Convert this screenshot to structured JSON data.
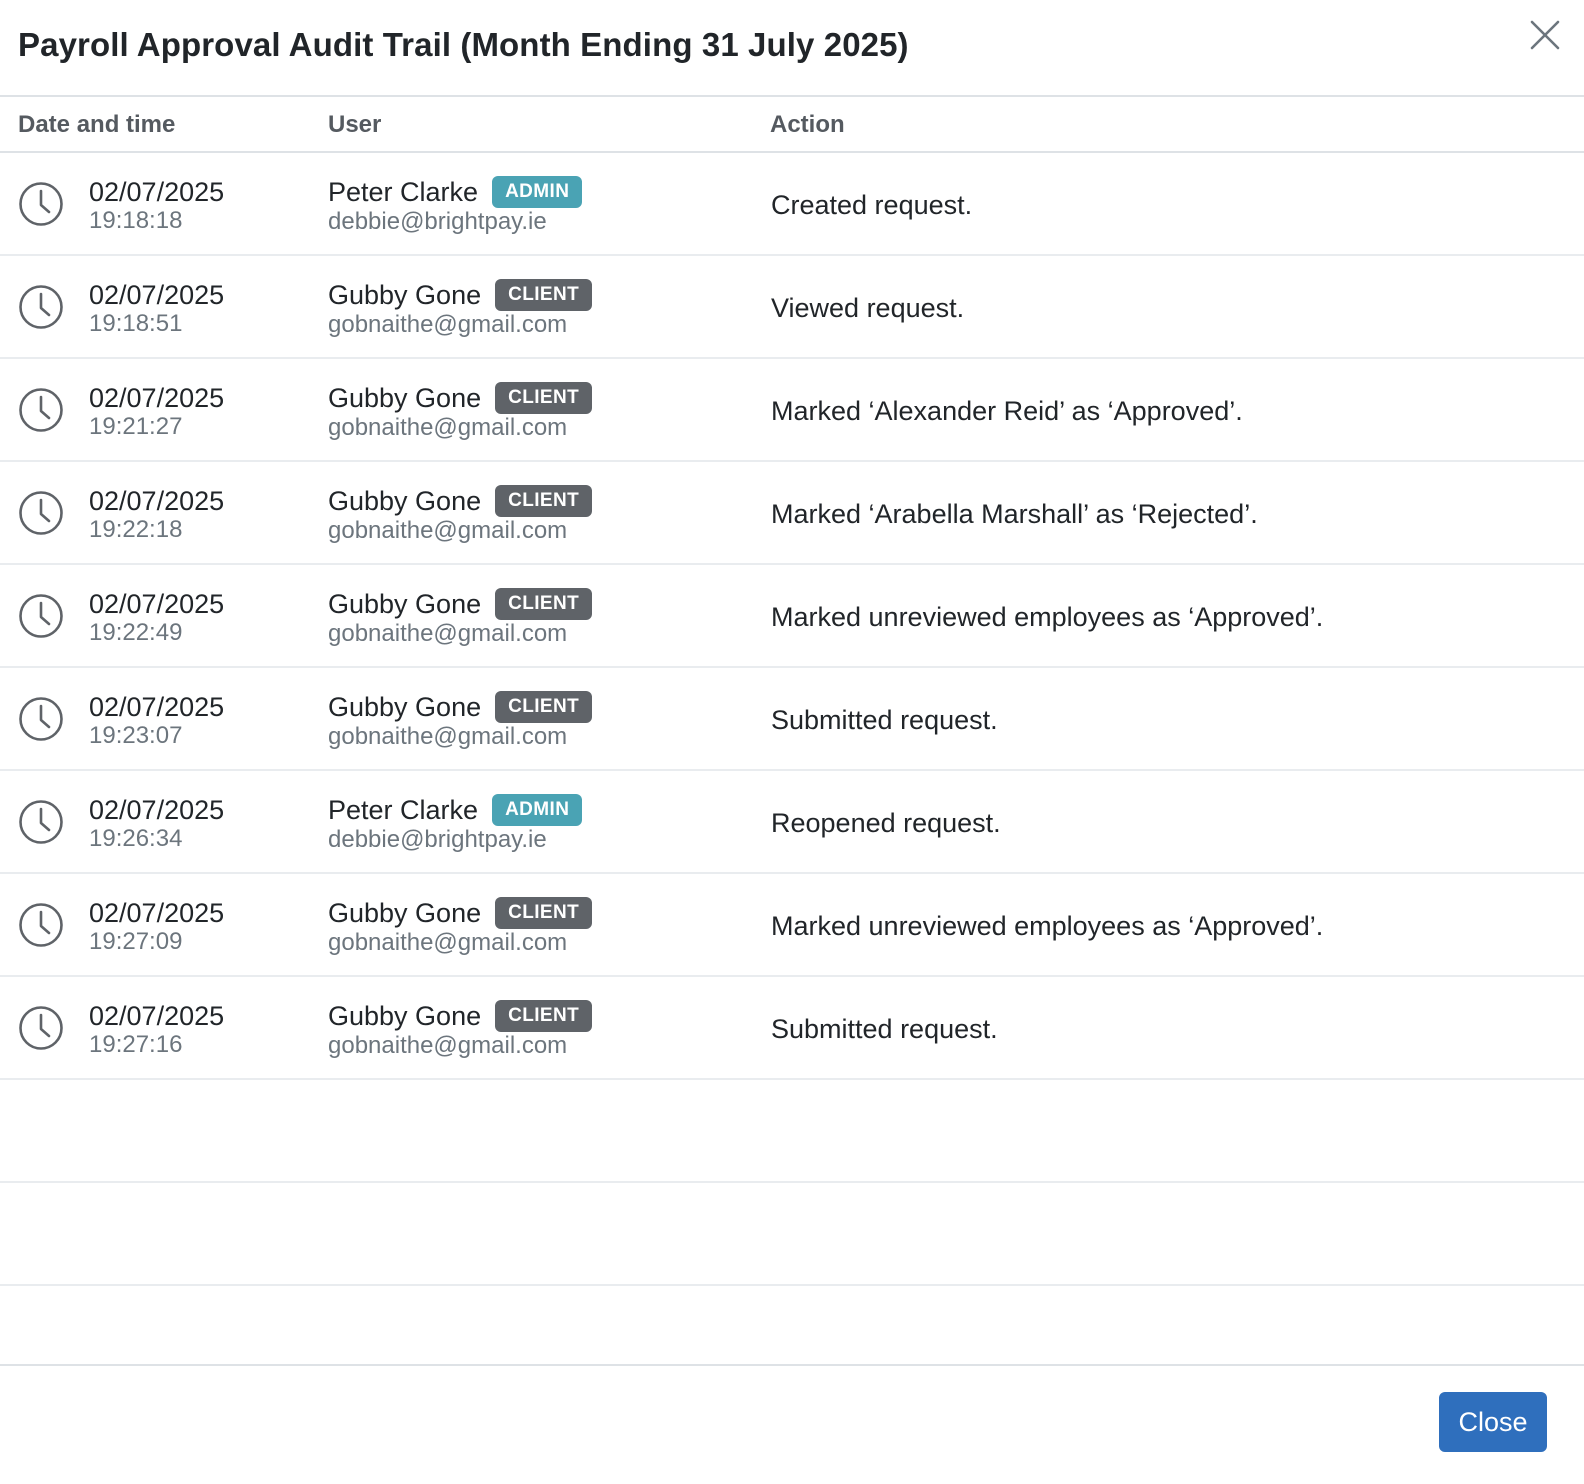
{
  "dialog": {
    "title": "Payroll Approval Audit Trail (Month Ending 31 July 2025)",
    "close_icon": "close-icon",
    "close_button_label": "Close"
  },
  "table": {
    "headers": [
      "Date and time",
      "User",
      "Action"
    ],
    "rows": [
      {
        "date": "02/07/2025",
        "time": "19:18:18",
        "user": "Peter Clarke",
        "role": "ADMIN",
        "email": "debbie@brightpay.ie",
        "action": "Created request."
      },
      {
        "date": "02/07/2025",
        "time": "19:18:51",
        "user": "Gubby Gone",
        "role": "CLIENT",
        "email": "gobnaithe@gmail.com",
        "action": "Viewed request."
      },
      {
        "date": "02/07/2025",
        "time": "19:21:27",
        "user": "Gubby Gone",
        "role": "CLIENT",
        "email": "gobnaithe@gmail.com",
        "action": "Marked ‘Alexander Reid’ as ‘Approved’."
      },
      {
        "date": "02/07/2025",
        "time": "19:22:18",
        "user": "Gubby Gone",
        "role": "CLIENT",
        "email": "gobnaithe@gmail.com",
        "action": "Marked ‘Arabella Marshall’ as ‘Rejected’."
      },
      {
        "date": "02/07/2025",
        "time": "19:22:49",
        "user": "Gubby Gone",
        "role": "CLIENT",
        "email": "gobnaithe@gmail.com",
        "action": "Marked unreviewed employees as ‘Approved’."
      },
      {
        "date": "02/07/2025",
        "time": "19:23:07",
        "user": "Gubby Gone",
        "role": "CLIENT",
        "email": "gobnaithe@gmail.com",
        "action": "Submitted request."
      },
      {
        "date": "02/07/2025",
        "time": "19:26:34",
        "user": "Peter Clarke",
        "role": "ADMIN",
        "email": "debbie@brightpay.ie",
        "action": "Reopened request."
      },
      {
        "date": "02/07/2025",
        "time": "19:27:09",
        "user": "Gubby Gone",
        "role": "CLIENT",
        "email": "gobnaithe@gmail.com",
        "action": "Marked unreviewed employees as ‘Approved’."
      },
      {
        "date": "02/07/2025",
        "time": "19:27:16",
        "user": "Gubby Gone",
        "role": "CLIENT",
        "email": "gobnaithe@gmail.com",
        "action": "Submitted request."
      }
    ],
    "row_icon": "clock-icon"
  },
  "colors": {
    "admin_badge": "#4aa3b4",
    "client_badge": "#5f6368",
    "primary_button": "#2f6fbd"
  }
}
